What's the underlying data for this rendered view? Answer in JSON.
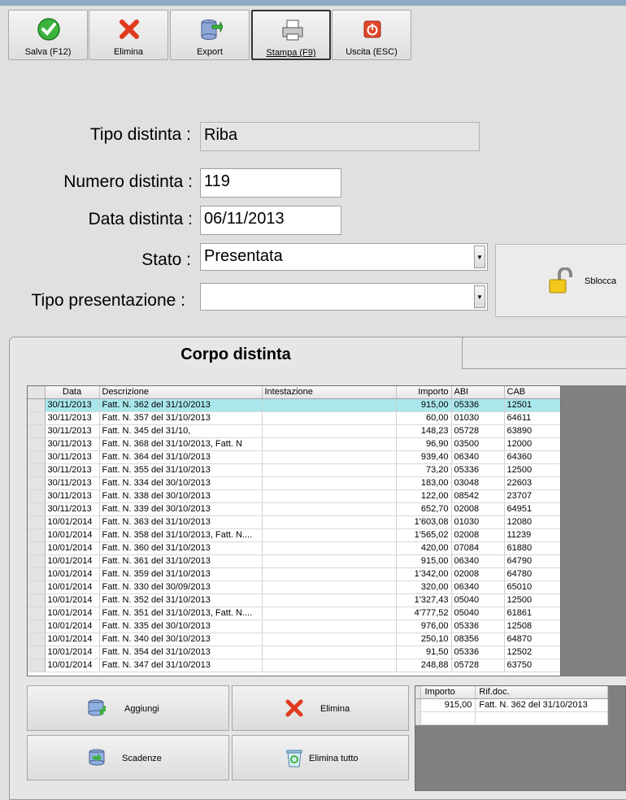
{
  "toolbar": {
    "buttons": [
      {
        "label": "Salva (F12)",
        "icon": "check-icon"
      },
      {
        "label": "Elimina",
        "icon": "red-x-icon"
      },
      {
        "label": "Export",
        "icon": "database-export-icon"
      },
      {
        "label": "Stampa (F9)",
        "icon": "printer-icon"
      },
      {
        "label": "Uscita (ESC)",
        "icon": "power-exit-icon"
      }
    ]
  },
  "form": {
    "tipo_distinta_label": "Tipo distinta :",
    "tipo_distinta_value": "Riba",
    "numero_label": "Numero distinta :",
    "numero_value": "119",
    "data_label": "Data distinta :",
    "data_value": "06/11/2013",
    "stato_label": "Stato :",
    "stato_value": "Presentata",
    "tipo_presentazione_label": "Tipo presentazione :",
    "tipo_presentazione_value": "",
    "sblocca_label": "Sblocca"
  },
  "tabs": {
    "active": "Corpo distinta"
  },
  "grid": {
    "headers": [
      "Data",
      "Descrizione",
      "Intestazione",
      "Importo",
      "ABI",
      "CAB"
    ],
    "rows": [
      {
        "data": "30/11/2013",
        "descrizione": "Fatt. N. 362 del 31/10/2013",
        "intestazione": "",
        "importo": "915,00",
        "abi": "05336",
        "cab": "12501"
      },
      {
        "data": "30/11/2013",
        "descrizione": "Fatt. N. 357 del 31/10/2013",
        "intestazione": "",
        "importo": "60,00",
        "abi": "01030",
        "cab": "64611"
      },
      {
        "data": "30/11/2013",
        "descrizione": "Fatt. N. 345 del 31/10,",
        "intestazione": "",
        "importo": "148,23",
        "abi": "05728",
        "cab": "63890"
      },
      {
        "data": "30/11/2013",
        "descrizione": "Fatt. N. 368 del 31/10/2013, Fatt. N",
        "intestazione": "",
        "importo": "96,90",
        "abi": "03500",
        "cab": "12000"
      },
      {
        "data": "30/11/2013",
        "descrizione": "Fatt. N. 364 del 31/10/2013",
        "intestazione": "",
        "importo": "939,40",
        "abi": "06340",
        "cab": "64360"
      },
      {
        "data": "30/11/2013",
        "descrizione": "Fatt. N. 355 del 31/10/2013",
        "intestazione": "",
        "importo": "73,20",
        "abi": "05336",
        "cab": "12500"
      },
      {
        "data": "30/11/2013",
        "descrizione": "Fatt. N. 334 del 30/10/2013",
        "intestazione": "",
        "importo": "183,00",
        "abi": "03048",
        "cab": "22603"
      },
      {
        "data": "30/11/2013",
        "descrizione": "Fatt. N. 338 del 30/10/2013",
        "intestazione": "",
        "importo": "122,00",
        "abi": "08542",
        "cab": "23707"
      },
      {
        "data": "30/11/2013",
        "descrizione": "Fatt. N. 339 del 30/10/2013",
        "intestazione": "",
        "importo": "652,70",
        "abi": "02008",
        "cab": "64951"
      },
      {
        "data": "10/01/2014",
        "descrizione": "Fatt. N. 363 del 31/10/2013",
        "intestazione": "",
        "importo": "1'603,08",
        "abi": "01030",
        "cab": "12080"
      },
      {
        "data": "10/01/2014",
        "descrizione": "Fatt. N. 358 del 31/10/2013, Fatt. N....",
        "intestazione": "",
        "importo": "1'565,02",
        "abi": "02008",
        "cab": "11239"
      },
      {
        "data": "10/01/2014",
        "descrizione": "Fatt. N. 360 del 31/10/2013",
        "intestazione": "",
        "importo": "420,00",
        "abi": "07084",
        "cab": "61880"
      },
      {
        "data": "10/01/2014",
        "descrizione": "Fatt. N. 361 del 31/10/2013",
        "intestazione": "",
        "importo": "915,00",
        "abi": "06340",
        "cab": "64790"
      },
      {
        "data": "10/01/2014",
        "descrizione": "Fatt. N. 359 del 31/10/2013",
        "intestazione": "",
        "importo": "1'342,00",
        "abi": "02008",
        "cab": "64780"
      },
      {
        "data": "10/01/2014",
        "descrizione": "Fatt. N. 330 del 30/09/2013",
        "intestazione": "",
        "importo": "320,00",
        "abi": "06340",
        "cab": "65010"
      },
      {
        "data": "10/01/2014",
        "descrizione": "Fatt. N. 352 del 31/10/2013",
        "intestazione": "",
        "importo": "1'327,43",
        "abi": "05040",
        "cab": "12500"
      },
      {
        "data": "10/01/2014",
        "descrizione": "Fatt. N. 351 del 31/10/2013, Fatt. N....",
        "intestazione": "",
        "importo": "4'777,52",
        "abi": "05040",
        "cab": "61861"
      },
      {
        "data": "10/01/2014",
        "descrizione": "Fatt. N. 335 del 30/10/2013",
        "intestazione": "",
        "importo": "976,00",
        "abi": "05336",
        "cab": "12508"
      },
      {
        "data": "10/01/2014",
        "descrizione": "Fatt. N. 340 del 30/10/2013",
        "intestazione": "",
        "importo": "250,10",
        "abi": "08356",
        "cab": "64870"
      },
      {
        "data": "10/01/2014",
        "descrizione": "Fatt. N. 354 del 31/10/2013",
        "intestazione": "",
        "importo": "91,50",
        "abi": "05336",
        "cab": "12502"
      },
      {
        "data": "10/01/2014",
        "descrizione": "Fatt. N. 347 del 31/10/2013",
        "intestazione": "",
        "importo": "248,88",
        "abi": "05728",
        "cab": "63750"
      }
    ]
  },
  "bottom_buttons": {
    "aggiungi": "Aggiungi",
    "elimina": "Elimina",
    "scadenze": "Scadenze",
    "elimina_tutto": "Elimina tutto"
  },
  "detail_grid": {
    "headers": [
      "Importo",
      "Rif.doc."
    ],
    "rows": [
      {
        "importo": "915,00",
        "rif": "Fatt. N. 362 del 31/10/2013"
      }
    ]
  },
  "colors": {
    "selected_row": "#a9e7ec",
    "title_bar": "#8fa9c4"
  }
}
